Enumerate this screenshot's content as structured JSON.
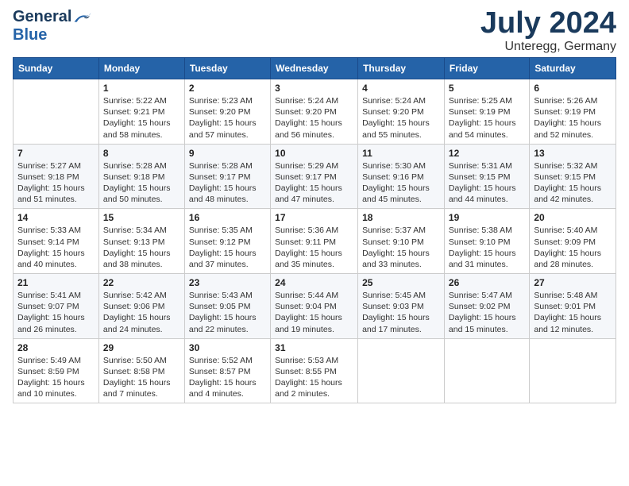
{
  "header": {
    "logo_general": "General",
    "logo_blue": "Blue",
    "month": "July 2024",
    "location": "Unteregg, Germany"
  },
  "days_of_week": [
    "Sunday",
    "Monday",
    "Tuesday",
    "Wednesday",
    "Thursday",
    "Friday",
    "Saturday"
  ],
  "weeks": [
    [
      {
        "day": "",
        "sunrise": "",
        "sunset": "",
        "daylight": ""
      },
      {
        "day": "1",
        "sunrise": "Sunrise: 5:22 AM",
        "sunset": "Sunset: 9:21 PM",
        "daylight": "Daylight: 15 hours and 58 minutes."
      },
      {
        "day": "2",
        "sunrise": "Sunrise: 5:23 AM",
        "sunset": "Sunset: 9:20 PM",
        "daylight": "Daylight: 15 hours and 57 minutes."
      },
      {
        "day": "3",
        "sunrise": "Sunrise: 5:24 AM",
        "sunset": "Sunset: 9:20 PM",
        "daylight": "Daylight: 15 hours and 56 minutes."
      },
      {
        "day": "4",
        "sunrise": "Sunrise: 5:24 AM",
        "sunset": "Sunset: 9:20 PM",
        "daylight": "Daylight: 15 hours and 55 minutes."
      },
      {
        "day": "5",
        "sunrise": "Sunrise: 5:25 AM",
        "sunset": "Sunset: 9:19 PM",
        "daylight": "Daylight: 15 hours and 54 minutes."
      },
      {
        "day": "6",
        "sunrise": "Sunrise: 5:26 AM",
        "sunset": "Sunset: 9:19 PM",
        "daylight": "Daylight: 15 hours and 52 minutes."
      }
    ],
    [
      {
        "day": "7",
        "sunrise": "Sunrise: 5:27 AM",
        "sunset": "Sunset: 9:18 PM",
        "daylight": "Daylight: 15 hours and 51 minutes."
      },
      {
        "day": "8",
        "sunrise": "Sunrise: 5:28 AM",
        "sunset": "Sunset: 9:18 PM",
        "daylight": "Daylight: 15 hours and 50 minutes."
      },
      {
        "day": "9",
        "sunrise": "Sunrise: 5:28 AM",
        "sunset": "Sunset: 9:17 PM",
        "daylight": "Daylight: 15 hours and 48 minutes."
      },
      {
        "day": "10",
        "sunrise": "Sunrise: 5:29 AM",
        "sunset": "Sunset: 9:17 PM",
        "daylight": "Daylight: 15 hours and 47 minutes."
      },
      {
        "day": "11",
        "sunrise": "Sunrise: 5:30 AM",
        "sunset": "Sunset: 9:16 PM",
        "daylight": "Daylight: 15 hours and 45 minutes."
      },
      {
        "day": "12",
        "sunrise": "Sunrise: 5:31 AM",
        "sunset": "Sunset: 9:15 PM",
        "daylight": "Daylight: 15 hours and 44 minutes."
      },
      {
        "day": "13",
        "sunrise": "Sunrise: 5:32 AM",
        "sunset": "Sunset: 9:15 PM",
        "daylight": "Daylight: 15 hours and 42 minutes."
      }
    ],
    [
      {
        "day": "14",
        "sunrise": "Sunrise: 5:33 AM",
        "sunset": "Sunset: 9:14 PM",
        "daylight": "Daylight: 15 hours and 40 minutes."
      },
      {
        "day": "15",
        "sunrise": "Sunrise: 5:34 AM",
        "sunset": "Sunset: 9:13 PM",
        "daylight": "Daylight: 15 hours and 38 minutes."
      },
      {
        "day": "16",
        "sunrise": "Sunrise: 5:35 AM",
        "sunset": "Sunset: 9:12 PM",
        "daylight": "Daylight: 15 hours and 37 minutes."
      },
      {
        "day": "17",
        "sunrise": "Sunrise: 5:36 AM",
        "sunset": "Sunset: 9:11 PM",
        "daylight": "Daylight: 15 hours and 35 minutes."
      },
      {
        "day": "18",
        "sunrise": "Sunrise: 5:37 AM",
        "sunset": "Sunset: 9:10 PM",
        "daylight": "Daylight: 15 hours and 33 minutes."
      },
      {
        "day": "19",
        "sunrise": "Sunrise: 5:38 AM",
        "sunset": "Sunset: 9:10 PM",
        "daylight": "Daylight: 15 hours and 31 minutes."
      },
      {
        "day": "20",
        "sunrise": "Sunrise: 5:40 AM",
        "sunset": "Sunset: 9:09 PM",
        "daylight": "Daylight: 15 hours and 28 minutes."
      }
    ],
    [
      {
        "day": "21",
        "sunrise": "Sunrise: 5:41 AM",
        "sunset": "Sunset: 9:07 PM",
        "daylight": "Daylight: 15 hours and 26 minutes."
      },
      {
        "day": "22",
        "sunrise": "Sunrise: 5:42 AM",
        "sunset": "Sunset: 9:06 PM",
        "daylight": "Daylight: 15 hours and 24 minutes."
      },
      {
        "day": "23",
        "sunrise": "Sunrise: 5:43 AM",
        "sunset": "Sunset: 9:05 PM",
        "daylight": "Daylight: 15 hours and 22 minutes."
      },
      {
        "day": "24",
        "sunrise": "Sunrise: 5:44 AM",
        "sunset": "Sunset: 9:04 PM",
        "daylight": "Daylight: 15 hours and 19 minutes."
      },
      {
        "day": "25",
        "sunrise": "Sunrise: 5:45 AM",
        "sunset": "Sunset: 9:03 PM",
        "daylight": "Daylight: 15 hours and 17 minutes."
      },
      {
        "day": "26",
        "sunrise": "Sunrise: 5:47 AM",
        "sunset": "Sunset: 9:02 PM",
        "daylight": "Daylight: 15 hours and 15 minutes."
      },
      {
        "day": "27",
        "sunrise": "Sunrise: 5:48 AM",
        "sunset": "Sunset: 9:01 PM",
        "daylight": "Daylight: 15 hours and 12 minutes."
      }
    ],
    [
      {
        "day": "28",
        "sunrise": "Sunrise: 5:49 AM",
        "sunset": "Sunset: 8:59 PM",
        "daylight": "Daylight: 15 hours and 10 minutes."
      },
      {
        "day": "29",
        "sunrise": "Sunrise: 5:50 AM",
        "sunset": "Sunset: 8:58 PM",
        "daylight": "Daylight: 15 hours and 7 minutes."
      },
      {
        "day": "30",
        "sunrise": "Sunrise: 5:52 AM",
        "sunset": "Sunset: 8:57 PM",
        "daylight": "Daylight: 15 hours and 4 minutes."
      },
      {
        "day": "31",
        "sunrise": "Sunrise: 5:53 AM",
        "sunset": "Sunset: 8:55 PM",
        "daylight": "Daylight: 15 hours and 2 minutes."
      },
      {
        "day": "",
        "sunrise": "",
        "sunset": "",
        "daylight": ""
      },
      {
        "day": "",
        "sunrise": "",
        "sunset": "",
        "daylight": ""
      },
      {
        "day": "",
        "sunrise": "",
        "sunset": "",
        "daylight": ""
      }
    ]
  ]
}
